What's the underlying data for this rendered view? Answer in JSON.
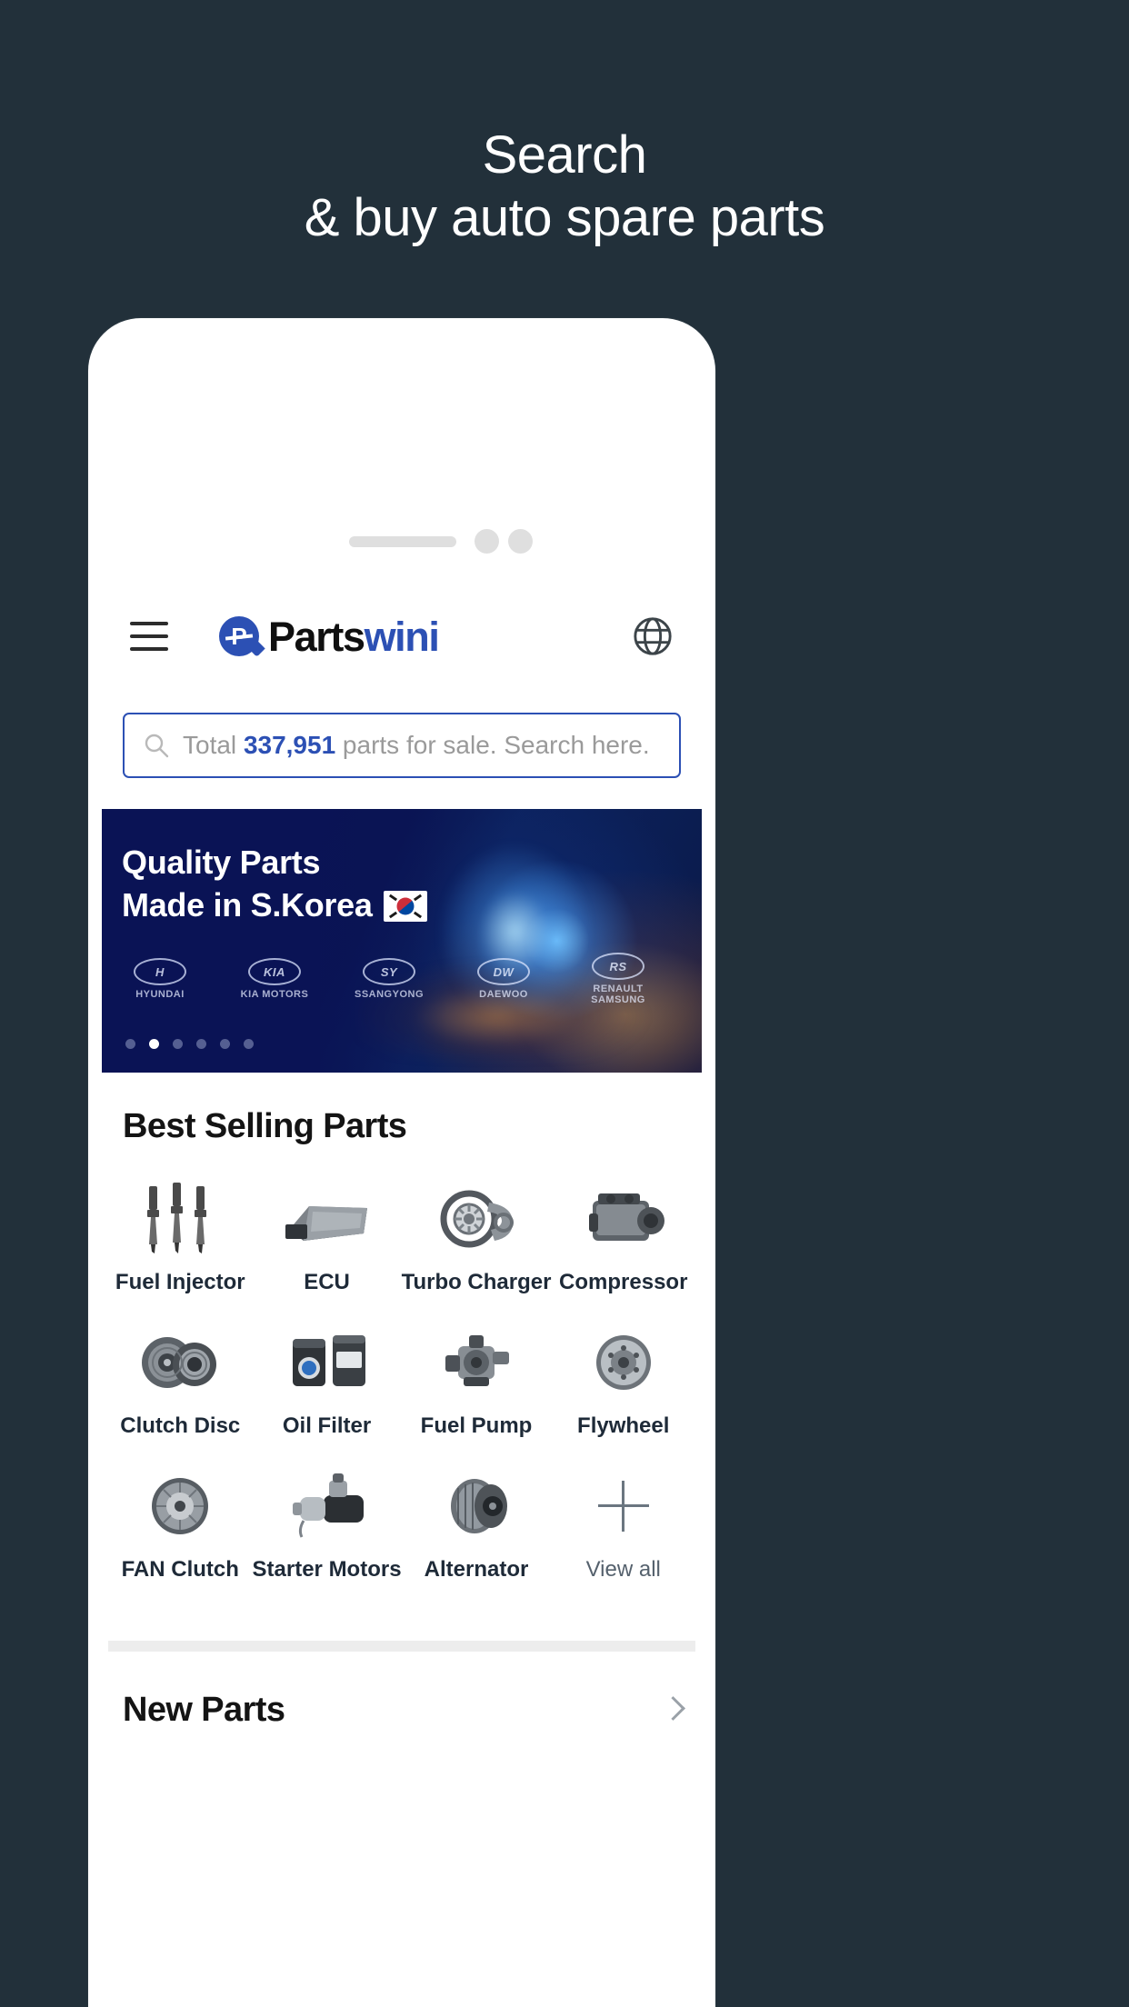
{
  "promo": {
    "line1": "Search",
    "line2": "& buy auto spare parts"
  },
  "app": {
    "header": {
      "menu_icon": "hamburger-icon",
      "brand_mark": "P",
      "brand_name_dark": "Parts",
      "brand_name_blue": "wini",
      "language_icon": "globe-icon"
    },
    "search": {
      "icon": "search-icon",
      "prefix": "Total ",
      "count": "337,951",
      "suffix": " parts for sale. Search here."
    },
    "banner": {
      "title_line1": "Quality Parts",
      "title_line2": "Made in S.Korea",
      "flag_icon": "south-korea-flag-icon",
      "brands": [
        {
          "mark": "H",
          "name": "HYUNDAI"
        },
        {
          "mark": "KIA",
          "name": "KIA MOTORS"
        },
        {
          "mark": "SY",
          "name": "SSANGYONG"
        },
        {
          "mark": "DW",
          "name": "DAEWOO"
        },
        {
          "mark": "RS",
          "name": "RENAULT SAMSUNG"
        }
      ],
      "dots_total": 6,
      "dots_active_index": 1
    },
    "best_selling": {
      "title": "Best Selling Parts",
      "items": [
        {
          "label": "Fuel Injector",
          "icon": "fuel-injector-icon"
        },
        {
          "label": "ECU",
          "icon": "ecu-icon"
        },
        {
          "label": "Turbo Charger",
          "icon": "turbo-charger-icon"
        },
        {
          "label": "Compressor",
          "icon": "compressor-icon"
        },
        {
          "label": "Clutch Disc",
          "icon": "clutch-disc-icon"
        },
        {
          "label": "Oil Filter",
          "icon": "oil-filter-icon"
        },
        {
          "label": "Fuel Pump",
          "icon": "fuel-pump-icon"
        },
        {
          "label": "Flywheel",
          "icon": "flywheel-icon"
        },
        {
          "label": "FAN Clutch",
          "icon": "fan-clutch-icon"
        },
        {
          "label": "Starter Motors",
          "icon": "starter-motor-icon"
        },
        {
          "label": "Alternator",
          "icon": "alternator-icon"
        },
        {
          "label": "View all",
          "icon": "plus-icon"
        }
      ]
    },
    "new_parts": {
      "title": "New Parts",
      "chevron_icon": "chevron-right-icon"
    }
  },
  "colors": {
    "page_background": "#22303a",
    "brand_blue": "#2c50b4",
    "banner_navy": "#0a1355",
    "text_dark": "#141414"
  }
}
